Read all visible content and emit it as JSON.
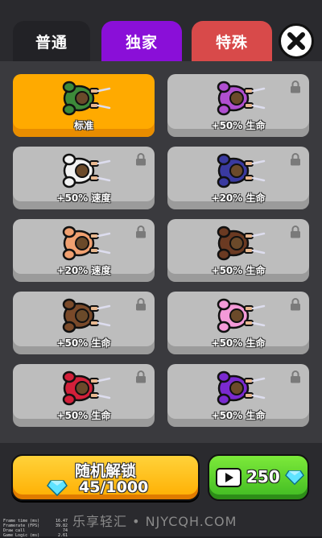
{
  "tabs": [
    {
      "label": "普通"
    },
    {
      "label": "独家"
    },
    {
      "label": "特殊"
    }
  ],
  "skins": [
    {
      "label": "标准",
      "selected": true,
      "locked": false,
      "color": "#3d8a3a"
    },
    {
      "label": "+50% 生命",
      "selected": false,
      "locked": true,
      "color": "#b04fd0"
    },
    {
      "label": "+50% 速度",
      "selected": false,
      "locked": true,
      "color": "#f2f2f2"
    },
    {
      "label": "+20% 生命",
      "selected": false,
      "locked": true,
      "color": "#3a3aa0"
    },
    {
      "label": "+20% 速度",
      "selected": false,
      "locked": true,
      "color": "#f0a070"
    },
    {
      "label": "+50% 生命",
      "selected": false,
      "locked": true,
      "color": "#6b3a22"
    },
    {
      "label": "+50% 生命",
      "selected": false,
      "locked": true,
      "color": "#7a4a2a"
    },
    {
      "label": "+50% 生命",
      "selected": false,
      "locked": true,
      "color": "#f39ad8"
    },
    {
      "label": "+50% 生命",
      "selected": false,
      "locked": true,
      "color": "#d3203a"
    },
    {
      "label": "+50% 生命",
      "selected": false,
      "locked": true,
      "color": "#7a2ad0"
    }
  ],
  "unlock": {
    "title": "随机解锁",
    "cost": "45/1000"
  },
  "video": {
    "price": "250"
  },
  "debug": [
    {
      "k": "Frame time (ms)",
      "v": "16.47"
    },
    {
      "k": "Framerate (FPS)",
      "v": "39.82"
    },
    {
      "k": "Draw call",
      "v": "74"
    },
    {
      "k": "Game Logic (ms)",
      "v": "2.61"
    }
  ],
  "watermark": "乐享轻汇 • NJYCQH.COM"
}
